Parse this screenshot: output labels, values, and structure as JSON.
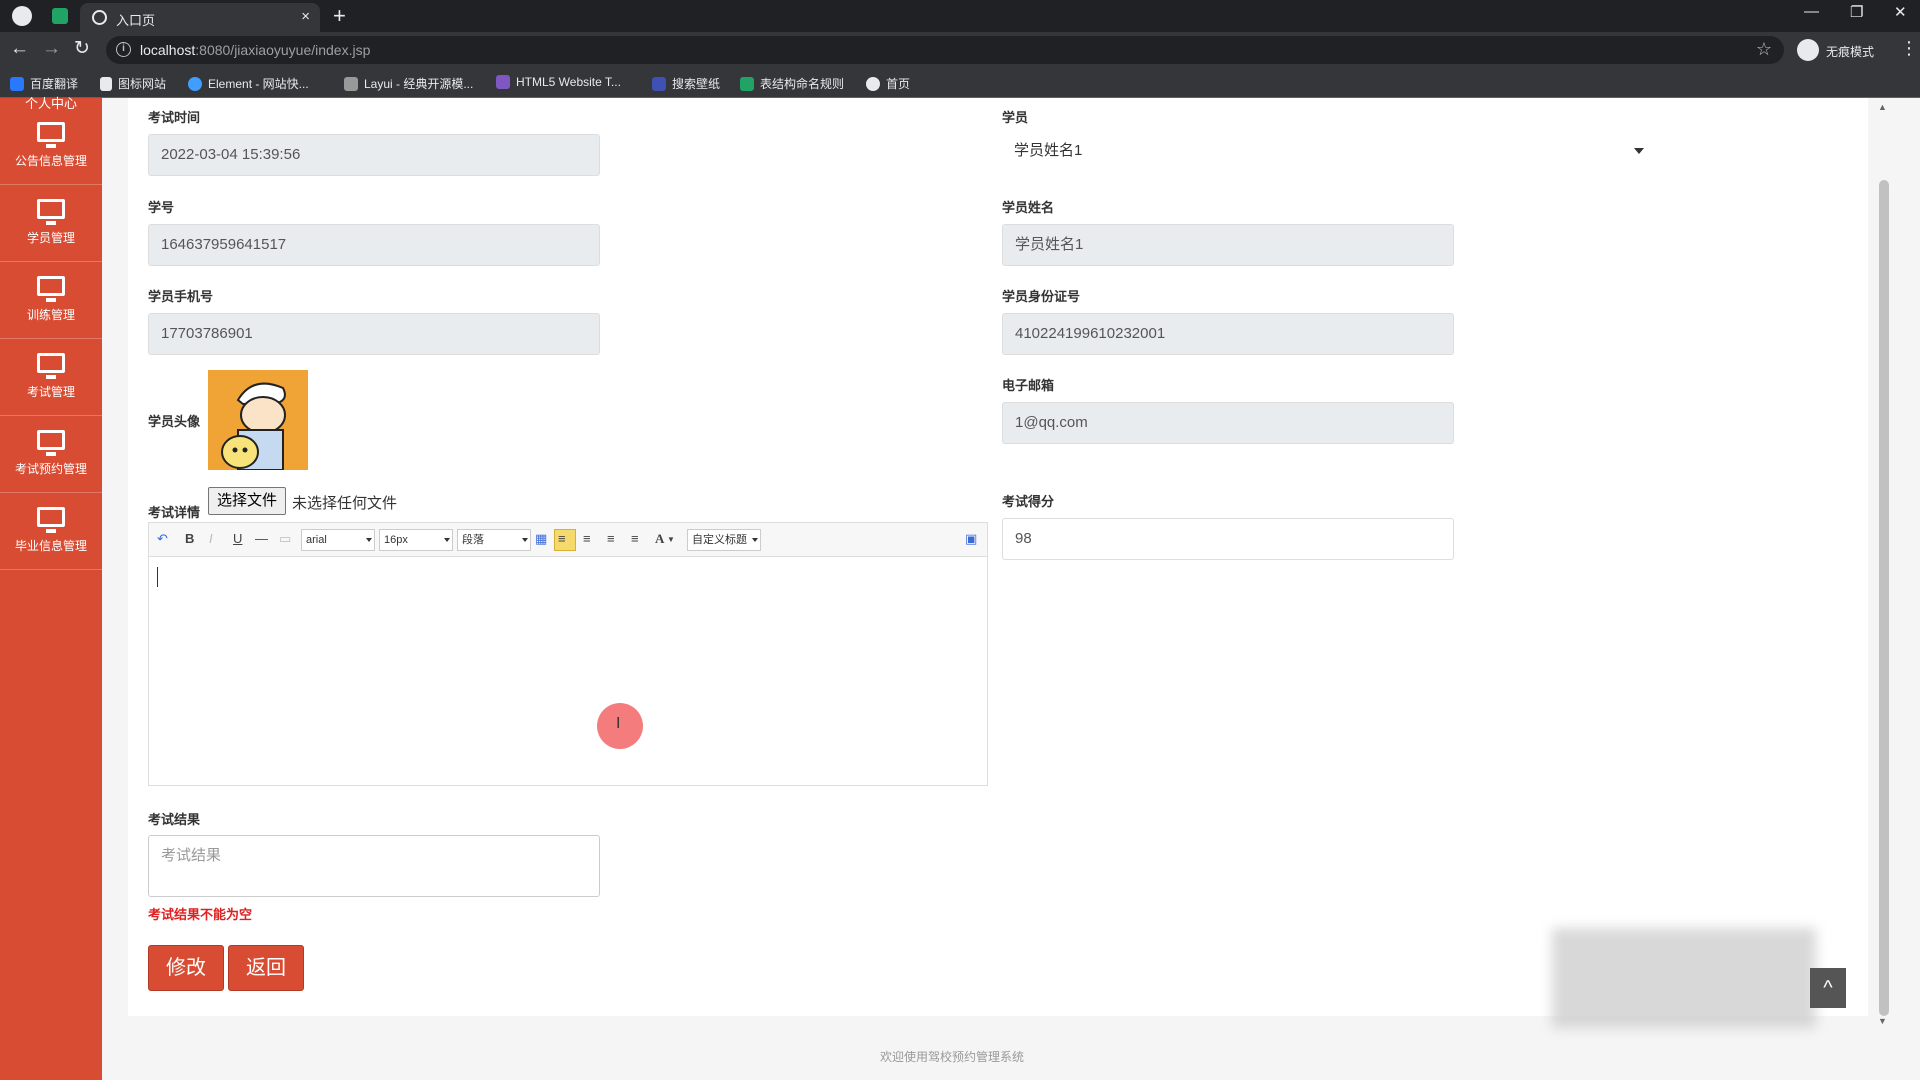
{
  "browser": {
    "tab_title": "入口页",
    "new_tab": "+",
    "close_tab": "×",
    "url_host": "localhost",
    "url_path": ":8080/jiaxiaoyuyue/index.jsp",
    "incognito_label": "无痕模式",
    "bookmarks": [
      {
        "label": "百度翻译",
        "color": "#2979ff"
      },
      {
        "label": "图标网站",
        "color": "#ffffff"
      },
      {
        "label": "Element - 网站快...",
        "color": "#409eff"
      },
      {
        "label": "Layui - 经典开源模...",
        "color": "#999999"
      },
      {
        "label": "HTML5 Website T...",
        "color": "#7e57c2"
      },
      {
        "label": "搜索壁纸",
        "color": "#3f51b5"
      },
      {
        "label": "表结构命名规则",
        "color": "#21a366"
      },
      {
        "label": "首页",
        "color": "#e8eaed"
      }
    ]
  },
  "sidebar": {
    "partial_top": "个人中心",
    "items": [
      {
        "label": "公告信息管理",
        "icon": "monitor-icon"
      },
      {
        "label": "学员管理",
        "icon": "monitor-icon"
      },
      {
        "label": "训练管理",
        "icon": "monitor-icon"
      },
      {
        "label": "考试管理",
        "icon": "monitor-icon"
      },
      {
        "label": "考试预约管理",
        "icon": "monitor-icon"
      },
      {
        "label": "毕业信息管理",
        "icon": "monitor-icon"
      }
    ]
  },
  "form": {
    "exam_time": {
      "label": "考试时间",
      "value": "2022-03-04 15:39:56"
    },
    "student": {
      "label": "学员",
      "value": "学员姓名1"
    },
    "student_no": {
      "label": "学号",
      "value": "164637959641517"
    },
    "student_name": {
      "label": "学员姓名",
      "value": "学员姓名1"
    },
    "phone": {
      "label": "学员手机号",
      "value": "17703786901"
    },
    "id_card": {
      "label": "学员身份证号",
      "value": "410224199610232001"
    },
    "avatar": {
      "label": "学员头像"
    },
    "email": {
      "label": "电子邮箱",
      "value": "1@qq.com"
    },
    "detail": {
      "label": "考试详情",
      "file_button": "选择文件",
      "file_status": "未选择任何文件"
    },
    "score": {
      "label": "考试得分",
      "value": "98"
    },
    "result": {
      "label": "考试结果",
      "placeholder": "考试结果",
      "error": "考试结果不能为空"
    },
    "editor_toolbar": {
      "undo": "↶",
      "bold": "B",
      "italic": "I",
      "underline": "U",
      "hr": "—",
      "font": "arial",
      "size": "16px",
      "paragraph": "段落",
      "font_color": "A",
      "custom_title": "自定义标题"
    }
  },
  "buttons": {
    "submit": "修改",
    "back": "返回"
  },
  "footer": "欢迎使用驾校预约管理系统",
  "colors": {
    "accent": "#d84c34",
    "error": "#e02020",
    "input_readonly": "#e9ecef"
  }
}
